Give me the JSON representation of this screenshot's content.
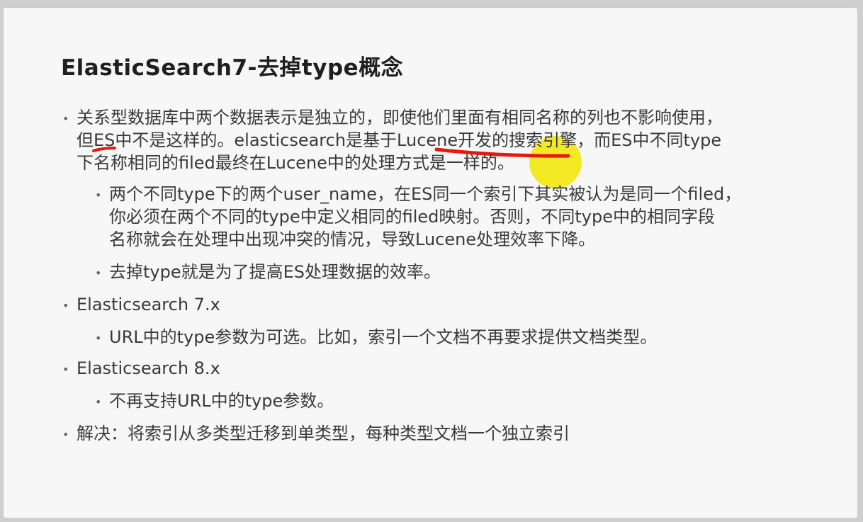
{
  "slide": {
    "title": "ElasticSearch7-去掉type概念",
    "bullets": [
      {
        "lines": [
          "关系型数据库中两个数据表示是独立的，即使他们里面有相同名称的列也不影响使用，",
          "但ES中不是这样的。elasticsearch是基于Lucene开发的搜索引擎，而ES中不同type",
          "下名称相同的filed最终在Lucene中的处理方式是一样的。"
        ],
        "sub": [
          {
            "lines": [
              "两个不同type下的两个user_name，在ES同一个索引下其实被认为是同一个filed，",
              "你必须在两个不同的type中定义相同的filed映射。否则，不同type中的相同字段",
              "名称就会在处理中出现冲突的情况，导致Lucene处理效率下降。"
            ]
          },
          {
            "lines": [
              "去掉type就是为了提高ES处理数据的效率。"
            ]
          }
        ]
      },
      {
        "lines": [
          "Elasticsearch 7.x"
        ],
        "sub": [
          {
            "lines": [
              "URL中的type参数为可选。比如，索引一个文档不再要求提供文档类型。"
            ]
          }
        ]
      },
      {
        "lines": [
          "Elasticsearch 8.x"
        ],
        "sub": [
          {
            "lines": [
              "不再支持URL中的type参数。"
            ]
          }
        ]
      },
      {
        "lines": [
          "解决：将索引从多类型迁移到单类型，每种类型文档一个独立索引"
        ],
        "sub": []
      }
    ]
  },
  "annotation": {
    "pen_color": "#e8190c",
    "highlight_color": "#f2e600"
  }
}
